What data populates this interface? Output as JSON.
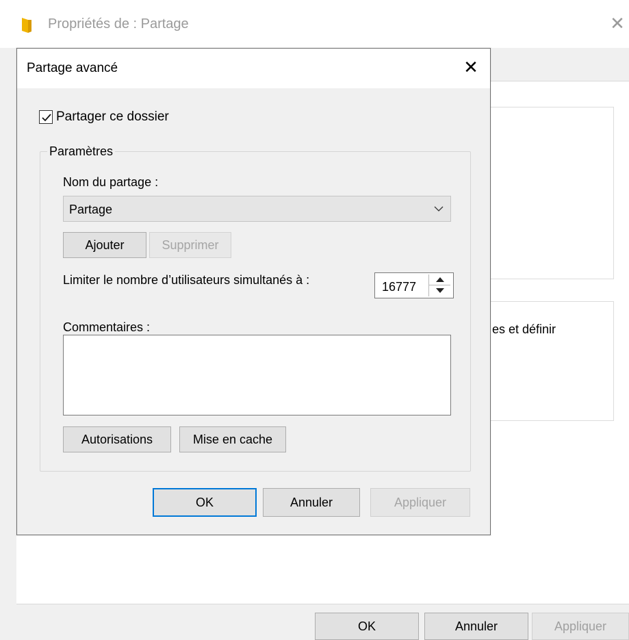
{
  "background_window": {
    "title": "Propriétés de : Partage",
    "partial_text": "es et définir",
    "buttons": {
      "ok": "OK",
      "cancel": "Annuler",
      "apply": "Appliquer"
    }
  },
  "dialog": {
    "title": "Partage avancé",
    "share_checkbox": {
      "label": "Partager ce dossier",
      "checked": true
    },
    "settings_group": {
      "legend": "Paramètres",
      "share_name_label": "Nom du partage :",
      "share_name_value": "Partage",
      "add_label": "Ajouter",
      "remove_label": "Supprimer",
      "limit_label": "Limiter le nombre d’utilisateurs simultanés à :",
      "limit_value": "16777",
      "comments_label": "Commentaires :",
      "comments_value": "",
      "permissions_label": "Autorisations",
      "caching_label": "Mise en cache"
    },
    "buttons": {
      "ok": "OK",
      "cancel": "Annuler",
      "apply": "Appliquer"
    }
  },
  "colors": {
    "focus_border": "#0078d7",
    "folder_icon": "#f0b400",
    "disabled_text": "#a5a5a5"
  },
  "icons": {
    "folder": "folder-icon",
    "close": "close-icon",
    "chevron": "chevron-down-icon",
    "spin_up": "arrow-up-icon",
    "spin_down": "arrow-down-icon",
    "check": "checkmark-icon"
  }
}
